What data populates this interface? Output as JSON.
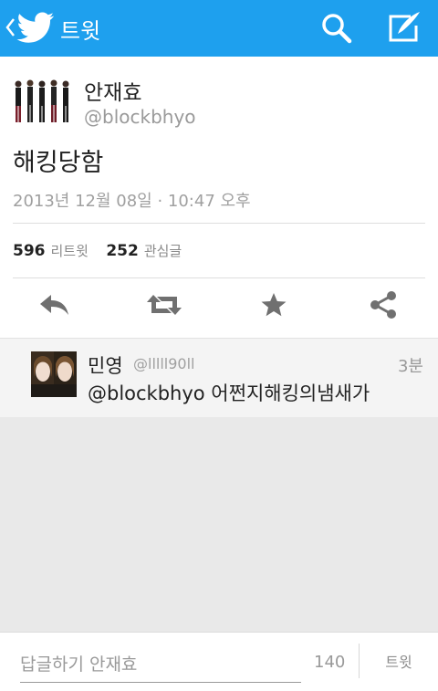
{
  "colors": {
    "topbar": "#1ea0ee",
    "action_icon": "#707070",
    "muted_text": "#9a9a9a"
  },
  "header": {
    "title": "트윗",
    "back_icon": "chevron-left-icon",
    "logo_icon": "twitter-bird-icon",
    "search_icon": "search-icon",
    "compose_icon": "compose-quill-icon"
  },
  "tweet": {
    "author_name": "안재효",
    "author_handle": "@blockbhyo",
    "text": "해킹당함",
    "timestamp": "2013년 12월 08일 · 10:47 오후",
    "retweet_count": "596",
    "retweet_label": "리트윗",
    "favorite_count": "252",
    "favorite_label": "관심글",
    "actions": [
      "reply-icon",
      "retweet-icon",
      "star-icon",
      "share-icon"
    ]
  },
  "reply": {
    "name": "민영",
    "handle": "@lllll90ll",
    "time": "3분",
    "text": "@blockbhyo 어쩐지해킹의냄새가"
  },
  "composer": {
    "placeholder": "답글하기 안재효",
    "char_count": "140",
    "tweet_label": "트윗"
  }
}
